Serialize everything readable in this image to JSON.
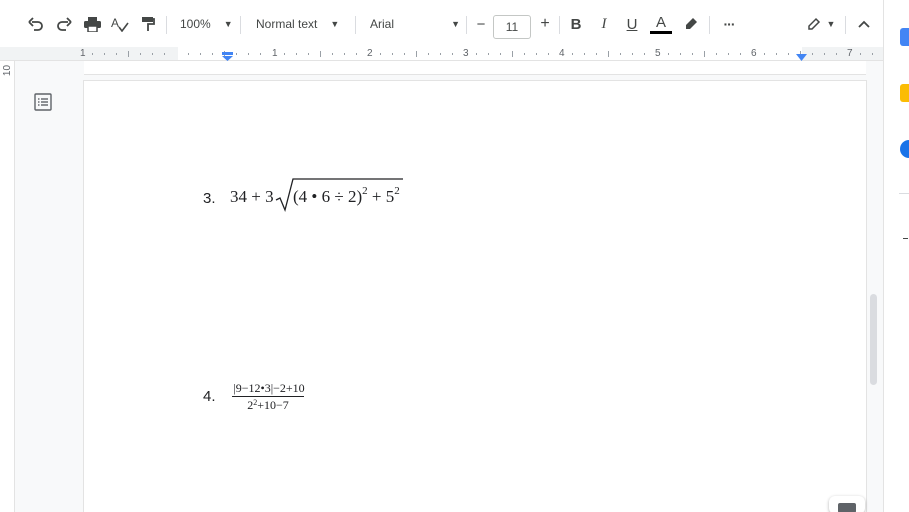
{
  "toolbar": {
    "zoom": "100%",
    "style": "Normal text",
    "font": "Arial",
    "font_size": "11",
    "minus": "−",
    "plus": "+",
    "bold": "B",
    "italic": "I",
    "underline": "U",
    "text_color": "A",
    "more": "···"
  },
  "ruler": {
    "numbers": [
      "1",
      "1",
      "2",
      "3",
      "4",
      "5",
      "6",
      "7"
    ]
  },
  "vruler": {
    "number": "10"
  },
  "document": {
    "item3": {
      "number": "3.",
      "prefix": "34 + 3",
      "radicand_open": "(4 • 6 ÷ 2)",
      "exp1": "2",
      "mid": " + 5",
      "exp2": "2"
    },
    "item4": {
      "number": "4.",
      "numerator": "|9−12•3|−2+10",
      "denominator_base": "2",
      "denominator_exp": "2",
      "denominator_rest": "+10−7"
    }
  },
  "colors": {
    "accent_blue": "#4285f4",
    "keep_yellow": "#fbbc04",
    "docs_blue": "#1a73e8"
  }
}
